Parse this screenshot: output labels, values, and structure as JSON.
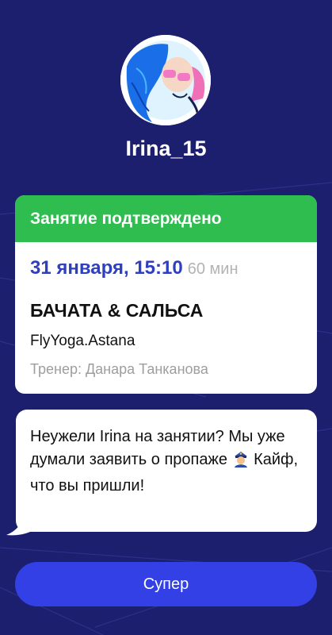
{
  "profile": {
    "username": "Irina_15"
  },
  "booking_card": {
    "header": "Занятие подтверждено",
    "date_time": "31 января, 15:10",
    "duration": "60 мин",
    "class_name": "БАЧАТА & САЛЬСА",
    "studio": "FlyYoga.Astana",
    "trainer": "Тренер: Данара Танканова"
  },
  "message": {
    "text_before_emoji": "Неужели Irina на занятии? Мы уже думали заявить о пропаже",
    "emoji": "police-officer-emoji",
    "text_after_emoji": "Кайф, что вы пришли!"
  },
  "actions": {
    "super_label": "Супер"
  },
  "colors": {
    "background": "#1c1f6e",
    "header_green": "#2ebd4e",
    "date_blue": "#2e3fbf",
    "button_blue": "#3340e6"
  }
}
